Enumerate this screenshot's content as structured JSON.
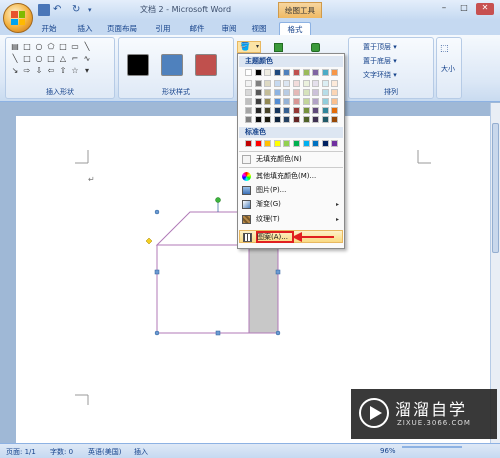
{
  "window": {
    "title": "文档 2 - Microsoft Word",
    "context_tab_group": "绘图工具"
  },
  "tabs": [
    {
      "label": "开始"
    },
    {
      "label": "插入"
    },
    {
      "label": "页面布局"
    },
    {
      "label": "引用"
    },
    {
      "label": "邮件"
    },
    {
      "label": "审阅"
    },
    {
      "label": "视图"
    },
    {
      "label": "格式",
      "active": true
    }
  ],
  "ribbon": {
    "insert_shapes_label": "插入形状",
    "shape_styles_label": "形状样式",
    "arrange_label": "排列",
    "size_label": "大小",
    "bring_to_front": "置于顶层",
    "send_to_back": "置于底层",
    "text_wrap": "文字环绕",
    "style_colors": [
      "#000000",
      "#4f81bd",
      "#c0504d"
    ]
  },
  "fill_menu": {
    "theme_colors_header": "主题颜色",
    "standard_colors_header": "标准色",
    "theme_top_row": [
      "#ffffff",
      "#000000",
      "#eeece1",
      "#1f497d",
      "#4f81bd",
      "#c0504d",
      "#9bbb59",
      "#8064a2",
      "#4bacc6",
      "#f79646"
    ],
    "theme_shades": [
      [
        "#f2f2f2",
        "#7f7f7f",
        "#ddd9c3",
        "#c6d9f0",
        "#dbe5f1",
        "#f2dcdb",
        "#ebf1dd",
        "#e5e0ec",
        "#dbeef3",
        "#fdeada"
      ],
      [
        "#d8d8d8",
        "#595959",
        "#c4bd97",
        "#8db3e2",
        "#b8cce4",
        "#e5b9b7",
        "#d7e3bc",
        "#ccc1d9",
        "#b7dde8",
        "#fbd5b5"
      ],
      [
        "#bfbfbf",
        "#3f3f3f",
        "#938953",
        "#548dd4",
        "#95b3d7",
        "#d99694",
        "#c3d69b",
        "#b2a2c7",
        "#92cddc",
        "#fac08f"
      ],
      [
        "#a5a5a5",
        "#262626",
        "#494429",
        "#17365d",
        "#366092",
        "#953734",
        "#76923c",
        "#5f497a",
        "#31859b",
        "#e36c09"
      ],
      [
        "#7f7f7f",
        "#0c0c0c",
        "#1d1b10",
        "#0f243e",
        "#244061",
        "#632423",
        "#4f6128",
        "#3f3151",
        "#205867",
        "#974806"
      ]
    ],
    "standard_colors": [
      "#c00000",
      "#ff0000",
      "#ffc000",
      "#ffff00",
      "#92d050",
      "#00b050",
      "#00b0f0",
      "#0070c0",
      "#002060",
      "#7030a0"
    ],
    "items": [
      {
        "label": "无填充颜色(N)",
        "icon": "no-fill-icon",
        "submenu": false
      },
      {
        "label": "其他填充颜色(M)...",
        "icon": "color-wheel-icon",
        "submenu": false
      },
      {
        "label": "图片(P)...",
        "icon": "picture-icon",
        "submenu": false
      },
      {
        "label": "渐变(G)",
        "icon": "gradient-icon",
        "submenu": true
      },
      {
        "label": "纹理(T)",
        "icon": "texture-icon",
        "submenu": true
      },
      {
        "label": "图案(A)...",
        "icon": "pattern-icon",
        "submenu": false,
        "highlighted": true
      }
    ],
    "highlight_color": "#e02020"
  },
  "status": {
    "page": "页面: 1/1",
    "words": "字数: 0",
    "language": "英语(美国)",
    "mode": "插入",
    "zoom": "96%"
  },
  "watermark": {
    "brand": "溜溜自学",
    "url": "ZIXUE.3066.COM"
  }
}
